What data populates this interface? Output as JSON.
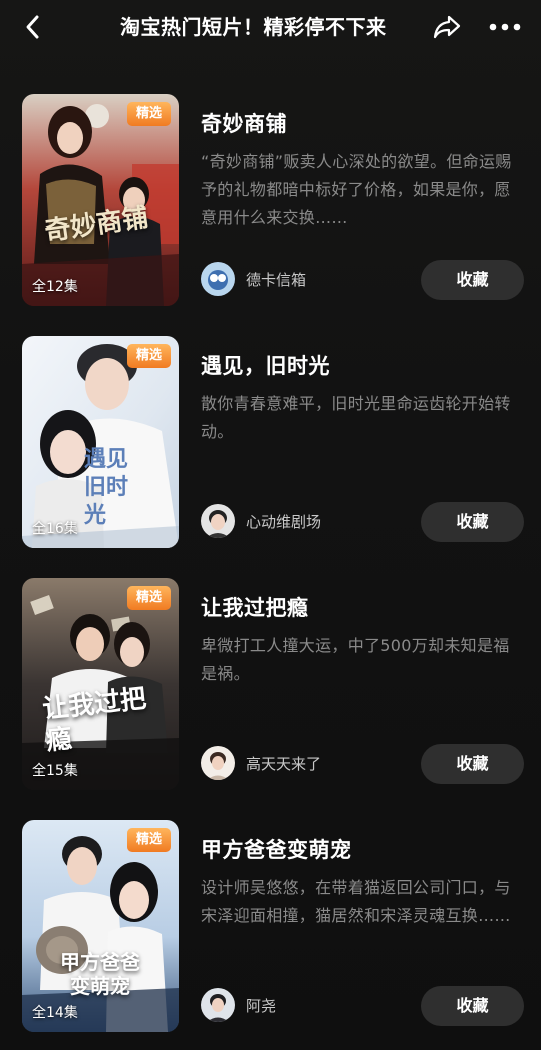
{
  "header": {
    "title": "淘宝热门短片！精彩停不下来",
    "back_icon": "chevron-left-icon",
    "share_icon": "share-icon",
    "more_icon": "more-dots-icon"
  },
  "cards": [
    {
      "title": "奇妙商铺",
      "description": "“奇妙商铺”贩卖人心深处的欲望。但命运赐予的礼物都暗中标好了价格，如果是你，愿意用什么来交换……",
      "badge": "精选",
      "episodes": "全12集",
      "poster_title": "奇妙商铺",
      "author": "德卡信箱",
      "button": "收藏"
    },
    {
      "title": "遇见，旧时光",
      "description": "散你青春意难平，旧时光里命运齿轮开始转动。",
      "badge": "精选",
      "episodes": "全16集",
      "poster_title": "遇见旧时光",
      "author": "心动维剧场",
      "button": "收藏"
    },
    {
      "title": "让我过把瘾",
      "description": "卑微打工人撞大运，中了500万却未知是福是祸。",
      "badge": "精选",
      "episodes": "全15集",
      "poster_title": "让我过把瘾",
      "author": "高天天来了",
      "button": "收藏"
    },
    {
      "title": "甲方爸爸变萌宠",
      "description": "设计师吴悠悠，在带着猫返回公司门口，与宋泽迎面相撞，猫居然和宋泽灵魂互换……",
      "badge": "精选",
      "episodes": "全14集",
      "poster_title": "甲方爸爸变萌宠",
      "author": "阿尧",
      "button": "收藏"
    }
  ],
  "colors": {
    "background": "#101010",
    "badge": "#f07b22",
    "button_bg": "#2f2f2f",
    "description": "#8a8a8a"
  }
}
